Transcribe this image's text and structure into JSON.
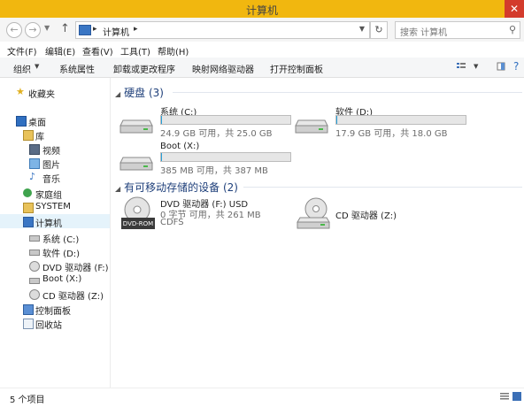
{
  "window": {
    "title": "计算机",
    "close": "✕"
  },
  "address": {
    "crumb": "计算机",
    "search_placeholder": "搜索 计算机"
  },
  "menu": [
    "文件(F)",
    "编辑(E)",
    "查看(V)",
    "工具(T)",
    "帮助(H)"
  ],
  "commands": [
    "组织",
    "系统属性",
    "卸载或更改程序",
    "映射网络驱动器",
    "打开控制面板"
  ],
  "nav": {
    "favorites": "收藏夹",
    "desktop": "桌面",
    "library": "库",
    "video": "视频",
    "pictures": "图片",
    "music": "音乐",
    "homegroup": "家庭组",
    "system": "SYSTEM",
    "computer": "计算机",
    "drive_c": "系统 (C:)",
    "drive_d": "软件 (D:)",
    "drive_f": "DVD 驱动器 (F:) U",
    "drive_x": "Boot (X:)",
    "drive_z": "CD 驱动器 (Z:)",
    "control_panel": "控制面板",
    "recycle": "回收站"
  },
  "groups": {
    "hdd": "硬盘 (3)",
    "removable": "有可移动存储的设备 (2)"
  },
  "drives": {
    "c": {
      "name": "系统 (C:)",
      "info": "24.9 GB 可用，共 25.0 GB",
      "used": 0.004
    },
    "d": {
      "name": "软件 (D:)",
      "info": "17.9 GB 可用，共 18.0 GB",
      "used": 0.006
    },
    "x": {
      "name": "Boot (X:)",
      "info": "385 MB 可用，共 387 MB",
      "used": 0.005
    },
    "f": {
      "name": "DVD 驱动器 (F:) USD",
      "info": "0 字节 可用，共 261 MB",
      "fs": "CDFS",
      "badge": "DVD-ROM"
    },
    "z": {
      "name": "CD 驱动器 (Z:)"
    }
  },
  "status": {
    "count": "5 个项目"
  },
  "colors": {
    "titlebar": "#f1b70f",
    "close": "#d33b2c",
    "group": "#1e3f7a",
    "selection": "#e5f3fb",
    "bar_fill": "#26a0da"
  }
}
